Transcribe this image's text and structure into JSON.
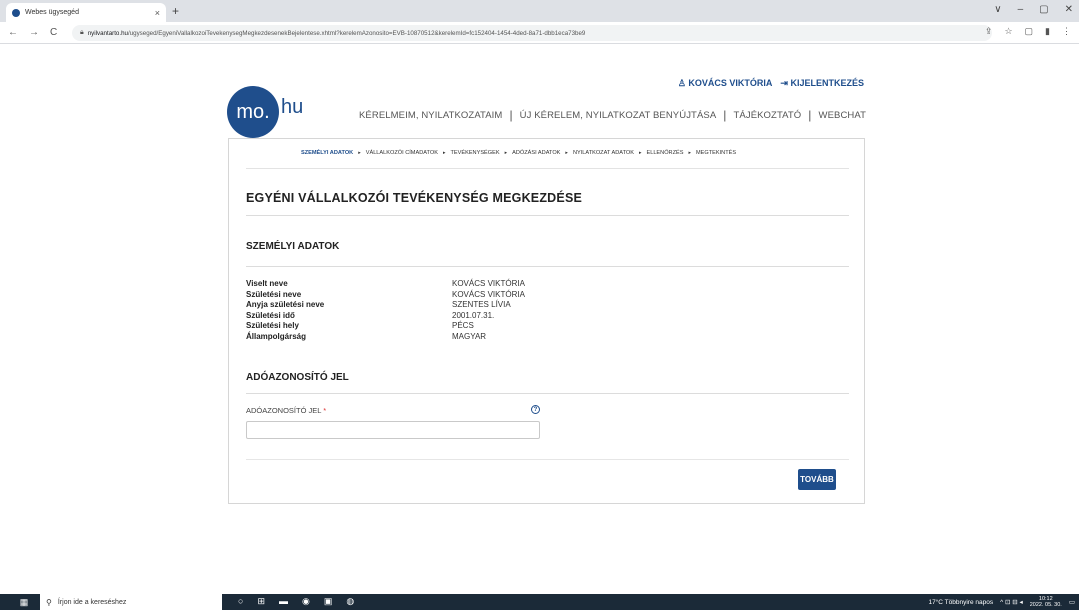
{
  "browser": {
    "tab_title": "Webes ügysegéd",
    "tab_close": "×",
    "new_tab": "+",
    "url_host": "nyilvantarto.hu",
    "url_path": "/ugyseged/EgyeniVallalkozoiTevekenysegMegkezdesenekBejelentese.xhtml?kerelemAzonosito=EVB-10870512&kerelemId=fc152404-1454-4ded-8a71-dbb1eca73be9",
    "nav": {
      "back": "←",
      "forward": "→",
      "reload": "C"
    },
    "window_controls": [
      "∨",
      "–",
      "▢",
      "✕"
    ],
    "toolbar_icons": [
      "⇪",
      "☆",
      "▢",
      "▮",
      "⋮"
    ]
  },
  "header": {
    "logo_circle": "mo.",
    "logo_suffix": "hu",
    "user_icon": "♙",
    "user_name": "KOVÁCS VIKTÓRIA",
    "logout_icon": "⇥",
    "logout_label": "KIJELENTKEZÉS",
    "nav": [
      "KÉRELMEIM, NYILATKOZATAIM",
      "ÚJ KÉRELEM, NYILATKOZAT BENYÚJTÁSA",
      "TÁJÉKOZTATÓ",
      "WEBCHAT"
    ],
    "nav_separator": "|"
  },
  "steps": {
    "items": [
      "SZEMÉLYI ADATOK",
      "VÁLLALKOZÓI CÍMADATOK",
      "TEVÉKENYSÉGEK",
      "ADÓZÁSI ADATOK",
      "NYILATKOZAT ADATOK",
      "ELLENŐRZÉS",
      "MEGTEKINTÉS"
    ],
    "arrow": "▸"
  },
  "main": {
    "page_title": "EGYÉNI VÁLLALKOZÓI TEVÉKENYSÉG MEGKEZDÉSE",
    "section_personal": "SZEMÉLYI ADATOK",
    "personal_rows": [
      {
        "label": "Viselt neve",
        "value": "KOVÁCS VIKTÓRIA"
      },
      {
        "label": "Születési neve",
        "value": "KOVÁCS VIKTÓRIA"
      },
      {
        "label": "Anyja születési neve",
        "value": "SZENTES LÍVIA"
      },
      {
        "label": "Születési idő",
        "value": "2001.07.31."
      },
      {
        "label": "Születési hely",
        "value": "PÉCS"
      },
      {
        "label": "Állampolgárság",
        "value": "MAGYAR"
      }
    ],
    "section_tax": "ADÓAZONOSÍTÓ JEL",
    "tax_field_label": "ADÓAZONOSÍTÓ JEL",
    "tax_field_required": "*",
    "tax_field_value": "",
    "help_icon": "?",
    "next_button": "TOVÁBB"
  },
  "taskbar": {
    "start_icon": "▦",
    "search_icon": "⚲",
    "search_placeholder": "Írjon ide a kereséshez",
    "app_icons": [
      "○",
      "⊞",
      "▬",
      "◉",
      "▣",
      "◍"
    ],
    "weather": "17°C  Többnyire napos",
    "tray_icons": "^ ⊡ ⊟ ◂",
    "time": "10:12",
    "date": "2022. 05. 30."
  },
  "colors": {
    "brand": "#1f4e8c",
    "taskbar": "#1b2a38",
    "required": "#dd3333"
  }
}
